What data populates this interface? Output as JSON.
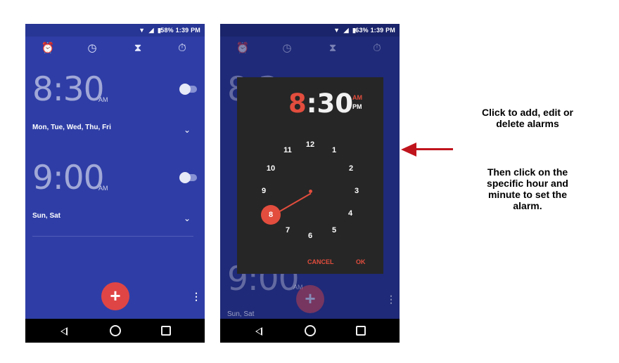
{
  "status": {
    "text": "58% 1:39 PM",
    "text_right": "63% 1:39 PM"
  },
  "tabs": {
    "alarm_icon": "alarm-clock-icon",
    "clock_icon": "clock-icon",
    "timer_icon": "hourglass-icon",
    "stopwatch_icon": "stopwatch-icon"
  },
  "alarms": [
    {
      "time": "8:30",
      "ampm": "AM",
      "days": "Mon, Tue, Wed, Thu, Fri"
    },
    {
      "time": "9:00",
      "ampm": "AM",
      "days": "Sun, Sat"
    }
  ],
  "right_phone": {
    "bottom_days": "Sun, Sat",
    "partial_time": "9:00",
    "partial_am": "AM",
    "bg_partial_81": "8:3"
  },
  "dialog": {
    "hour": "8",
    "rest": ":30",
    "am": "AM",
    "pm": "PM",
    "numbers": [
      "12",
      "1",
      "2",
      "3",
      "4",
      "5",
      "6",
      "7",
      "8",
      "9",
      "10",
      "11"
    ],
    "selected": "8",
    "cancel": "CANCEL",
    "ok": "OK"
  },
  "annotation": {
    "line1": "Click to add, edit or",
    "line2": "delete alarms",
    "line3": "Then click on the",
    "line4": "specific hour and",
    "line5": "minute to set the",
    "line6": "alarm."
  },
  "colors": {
    "app_bg": "#2f3ea6",
    "accent": "#e24d3d",
    "arrow": "#c0141d"
  }
}
